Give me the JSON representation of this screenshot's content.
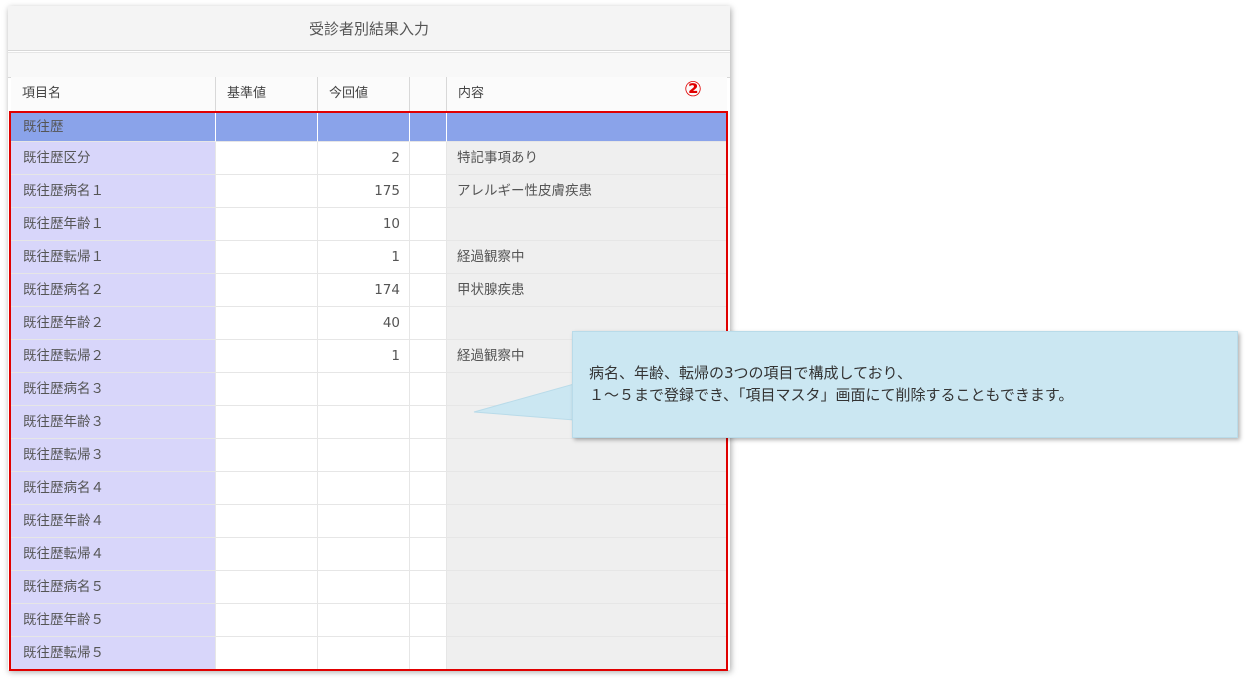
{
  "window": {
    "title": "受診者別結果入力"
  },
  "annotation": {
    "mark": "②"
  },
  "columns": [
    "項目名",
    "基準値",
    "今回値",
    "",
    "内容"
  ],
  "section_row": {
    "name": "既往歴"
  },
  "rows": [
    {
      "name": "既往歴区分",
      "current": "2",
      "content": "特記事項あり"
    },
    {
      "name": "既往歴病名１",
      "current": "175",
      "content": "アレルギー性皮膚疾患"
    },
    {
      "name": "既往歴年齢１",
      "current": "10",
      "content": ""
    },
    {
      "name": "既往歴転帰１",
      "current": "1",
      "content": "経過観察中"
    },
    {
      "name": "既往歴病名２",
      "current": "174",
      "content": "甲状腺疾患"
    },
    {
      "name": "既往歴年齢２",
      "current": "40",
      "content": ""
    },
    {
      "name": "既往歴転帰２",
      "current": "1",
      "content": "経過観察中"
    },
    {
      "name": "既往歴病名３",
      "current": "",
      "content": ""
    },
    {
      "name": "既往歴年齢３",
      "current": "",
      "content": ""
    },
    {
      "name": "既往歴転帰３",
      "current": "",
      "content": ""
    },
    {
      "name": "既往歴病名４",
      "current": "",
      "content": ""
    },
    {
      "name": "既往歴年齢４",
      "current": "",
      "content": ""
    },
    {
      "name": "既往歴転帰４",
      "current": "",
      "content": ""
    },
    {
      "name": "既往歴病名５",
      "current": "",
      "content": ""
    },
    {
      "name": "既往歴年齢５",
      "current": "",
      "content": ""
    },
    {
      "name": "既往歴転帰５",
      "current": "",
      "content": ""
    }
  ],
  "callout": {
    "line1": "病名、年齢、転帰の3つの項目で構成しており、",
    "line2": "１～５まで登録でき、「項目マスタ」画面にて削除することもできます。"
  },
  "colors": {
    "highlight_border": "#e00000",
    "section_bg": "#8aa3ea",
    "name_col_bg": "#d8d6fa",
    "callout_bg": "#cbe7f2"
  }
}
